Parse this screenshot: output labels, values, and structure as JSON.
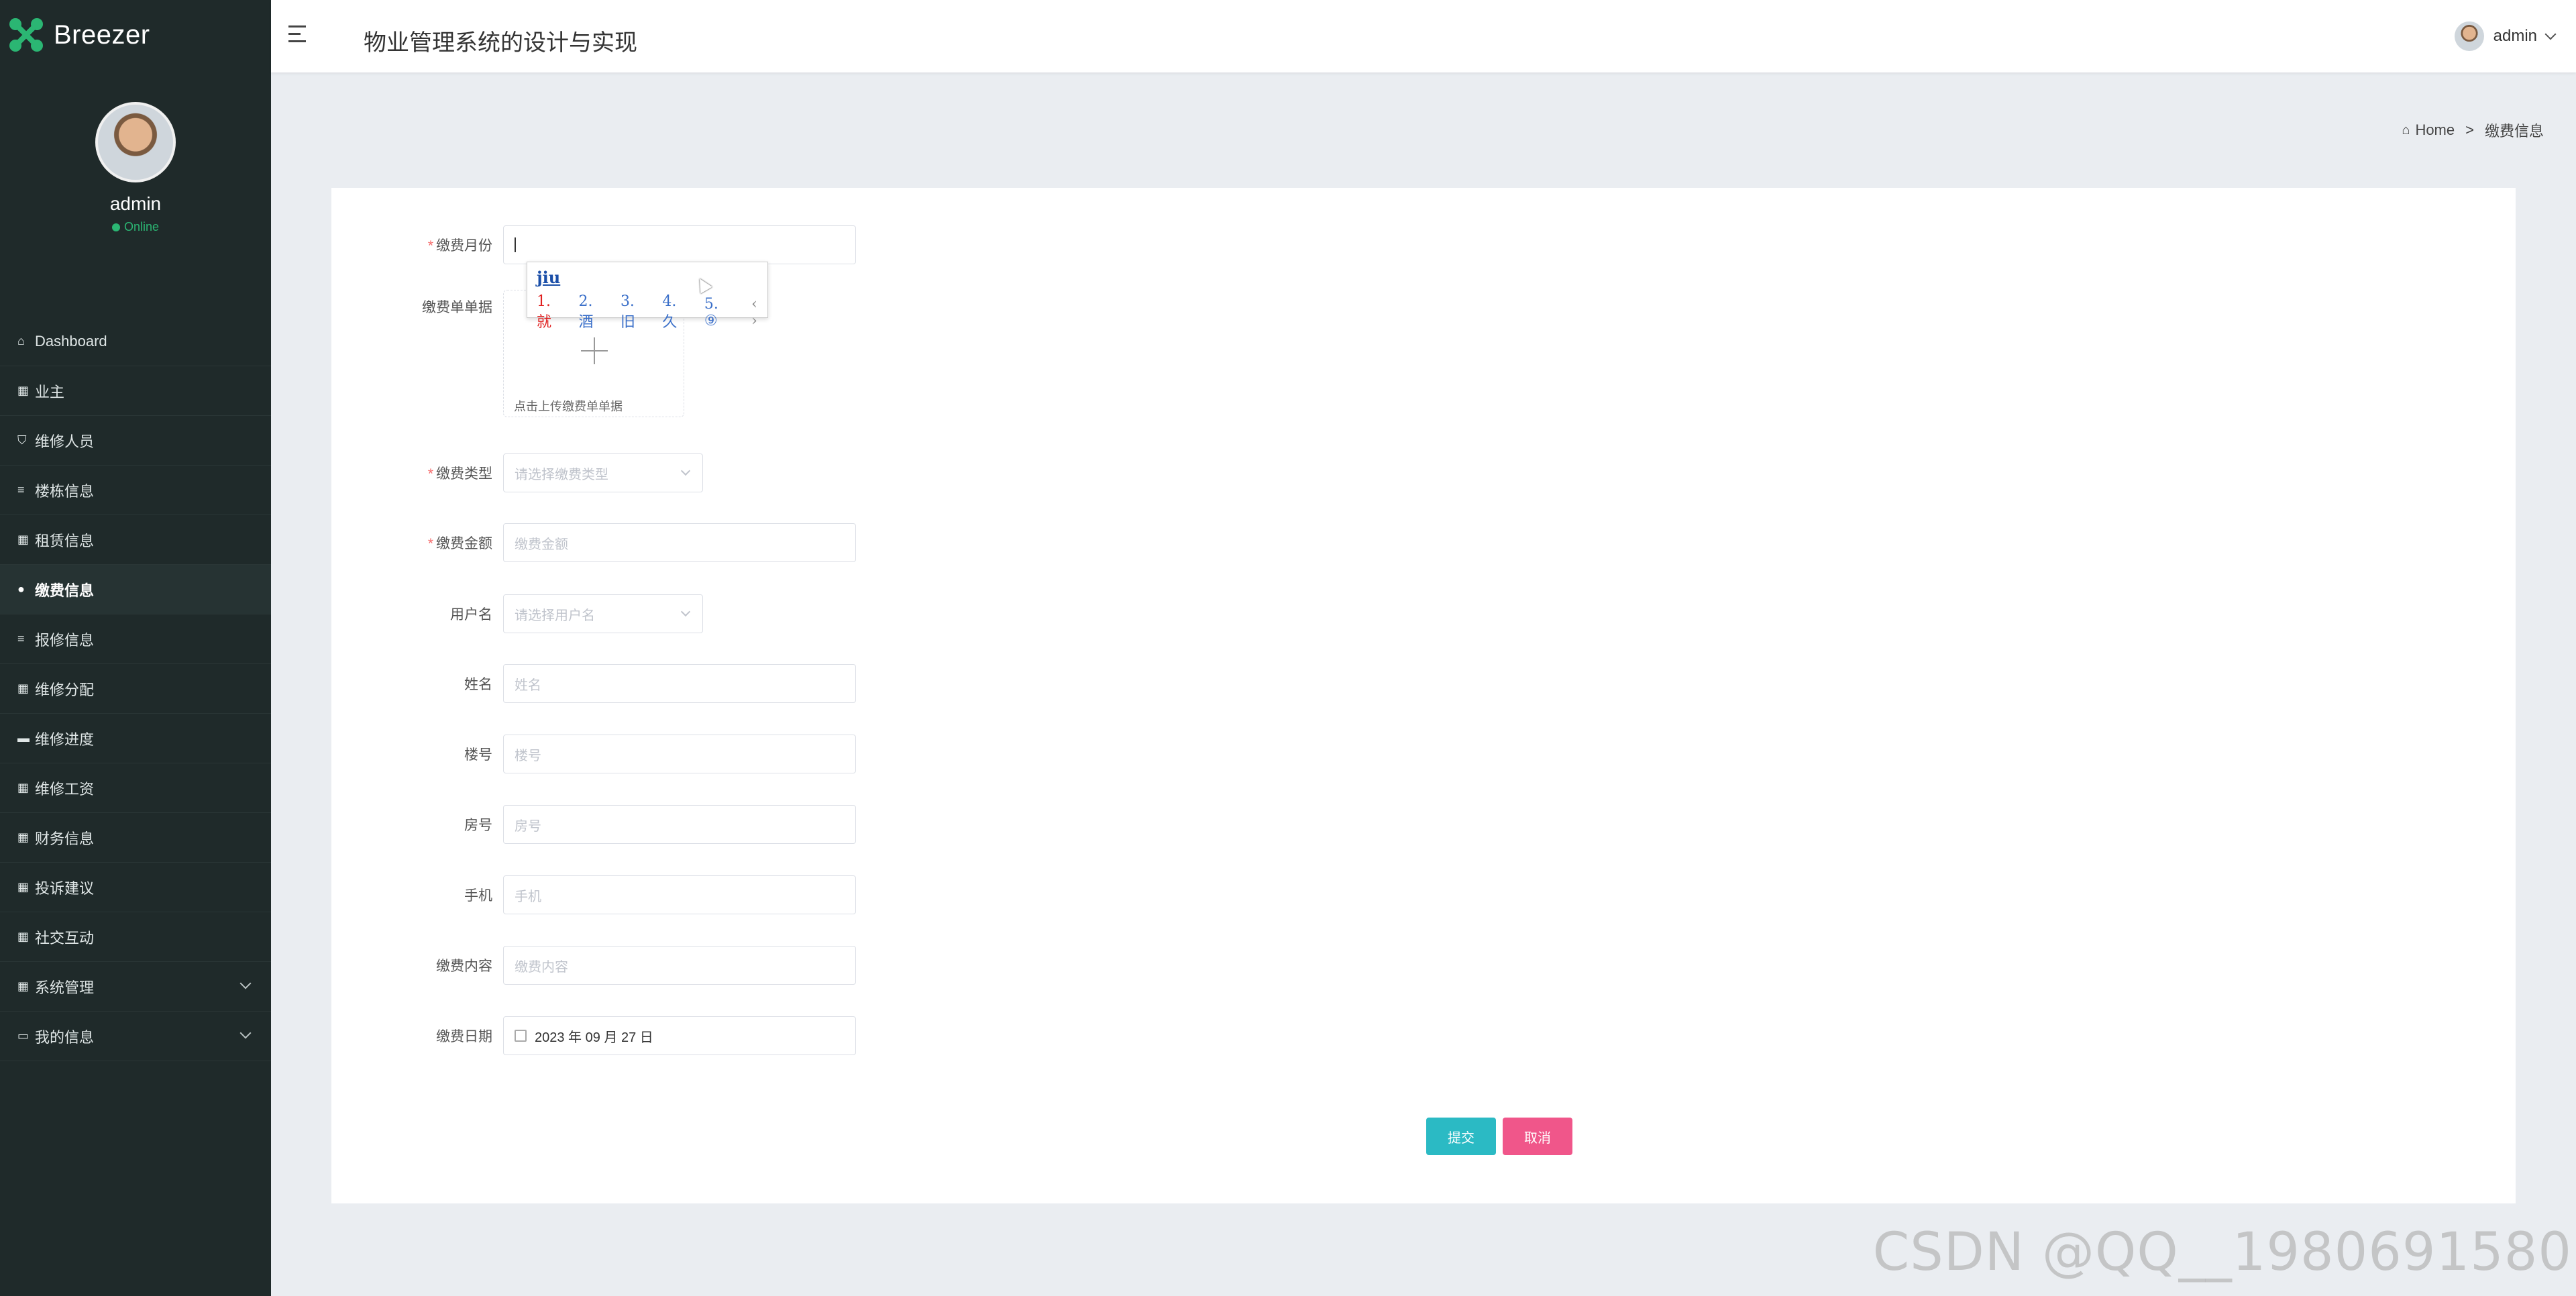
{
  "brand": {
    "name": "Breezer"
  },
  "profile": {
    "name": "admin",
    "status": "Online"
  },
  "sidebar": {
    "items": [
      {
        "icon": "⌂",
        "label": "Dashboard"
      },
      {
        "icon": "▦",
        "label": "业主"
      },
      {
        "icon": "⛉",
        "label": "维修人员"
      },
      {
        "icon": "≡",
        "label": "楼栋信息"
      },
      {
        "icon": "▦",
        "label": "租赁信息"
      },
      {
        "icon": "●",
        "label": "缴费信息",
        "active": true
      },
      {
        "icon": "≡",
        "label": "报修信息"
      },
      {
        "icon": "▦",
        "label": "维修分配"
      },
      {
        "icon": "▬",
        "label": "维修进度"
      },
      {
        "icon": "▦",
        "label": "维修工资"
      },
      {
        "icon": "▦",
        "label": "财务信息"
      },
      {
        "icon": "▦",
        "label": "投诉建议"
      },
      {
        "icon": "▦",
        "label": "社交互动"
      },
      {
        "icon": "▦",
        "label": "系统管理"
      },
      {
        "icon": "▭",
        "label": "我的信息"
      }
    ]
  },
  "header": {
    "title": "物业管理系统的设计与实现",
    "user": "admin"
  },
  "breadcrumb": {
    "home": "Home",
    "separator": ">",
    "current": "缴费信息"
  },
  "form": {
    "month_label": "缴费月份",
    "receipt_label": "缴费单单据",
    "upload_tip": "点击上传缴费单单据",
    "type_label": "缴费类型",
    "type_placeholder": "请选择缴费类型",
    "amount_label": "缴费金额",
    "amount_placeholder": "缴费金额",
    "username_label": "用户名",
    "username_placeholder": "请选择用户名",
    "name_label": "姓名",
    "name_placeholder": "姓名",
    "building_label": "楼号",
    "building_placeholder": "楼号",
    "room_label": "房号",
    "room_placeholder": "房号",
    "phone_label": "手机",
    "phone_placeholder": "手机",
    "content_label": "缴费内容",
    "content_placeholder": "缴费内容",
    "date_label": "缴费日期",
    "date_value": "2023 年 09 月 27 日",
    "submit": "提交",
    "cancel": "取消"
  },
  "ime": {
    "composition": "jiu",
    "candidates": [
      "1. 就",
      "2. 酒",
      "3. 旧",
      "4. 久",
      "5. ⑨"
    ],
    "nav": "‹ ›"
  },
  "watermark": "CSDN @QQ__1980691580",
  "colors": {
    "sidebar_bg": "#1f2a2a",
    "accent_green": "#2bb673",
    "submit": "#2bbac4",
    "cancel": "#f0568a"
  }
}
